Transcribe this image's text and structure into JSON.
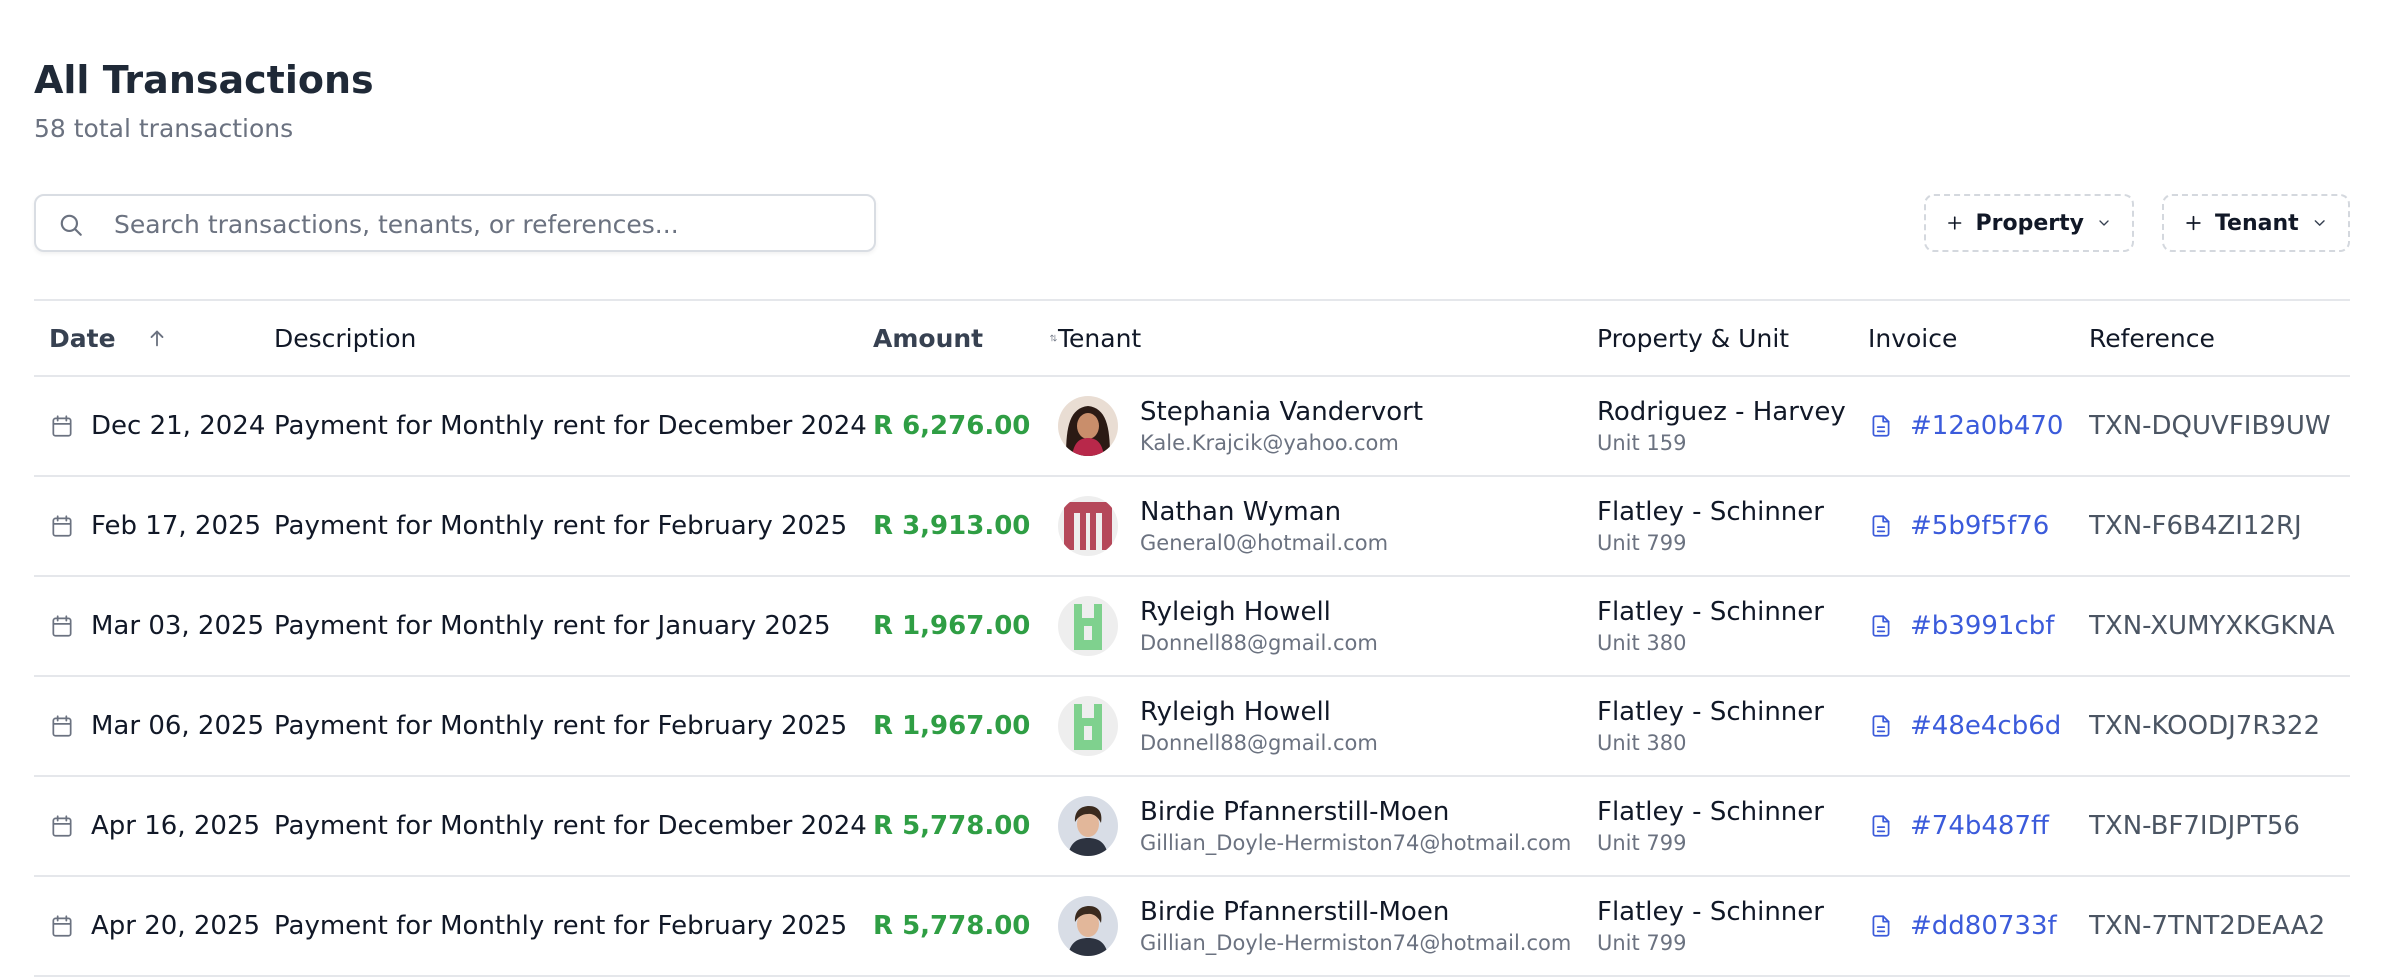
{
  "header": {
    "title": "All Transactions",
    "subtitle": "58 total transactions"
  },
  "search": {
    "placeholder": "Search transactions, tenants, or references...",
    "value": ""
  },
  "filters": [
    {
      "label": "Property",
      "icon": "plus-icon"
    },
    {
      "label": "Tenant",
      "icon": "plus-icon"
    }
  ],
  "table": {
    "columns": {
      "date": "Date",
      "description": "Description",
      "amount": "Amount",
      "tenant": "Tenant",
      "property": "Property & Unit",
      "invoice": "Invoice",
      "reference": "Reference"
    },
    "sort": {
      "date": "ascending",
      "amount": "unsorted"
    },
    "rows": [
      {
        "date": "Dec 21, 2024",
        "description": "Payment for Monthly rent for December 2024",
        "amount": "R 6,276.00",
        "tenant_name": "Stephania Vandervort",
        "tenant_email": "Kale.Krajcik@yahoo.com",
        "avatar": "photo-woman",
        "property": "Rodriguez - Harvey",
        "unit": "Unit 159",
        "invoice": "#12a0b470",
        "reference": "TXN-DQUVFIB9UW"
      },
      {
        "date": "Feb 17, 2025",
        "description": "Payment for Monthly rent for February 2025",
        "amount": "R 3,913.00",
        "tenant_name": "Nathan Wyman",
        "tenant_email": "General0@hotmail.com",
        "avatar": "identicon-red",
        "property": "Flatley - Schinner",
        "unit": "Unit 799",
        "invoice": "#5b9f5f76",
        "reference": "TXN-F6B4ZI12RJ"
      },
      {
        "date": "Mar 03, 2025",
        "description": "Payment for Monthly rent for January 2025",
        "amount": "R 1,967.00",
        "tenant_name": "Ryleigh Howell",
        "tenant_email": "Donnell88@gmail.com",
        "avatar": "identicon-green",
        "property": "Flatley - Schinner",
        "unit": "Unit 380",
        "invoice": "#b3991cbf",
        "reference": "TXN-XUMYXKGKNA"
      },
      {
        "date": "Mar 06, 2025",
        "description": "Payment for Monthly rent for February 2025",
        "amount": "R 1,967.00",
        "tenant_name": "Ryleigh Howell",
        "tenant_email": "Donnell88@gmail.com",
        "avatar": "identicon-green",
        "property": "Flatley - Schinner",
        "unit": "Unit 380",
        "invoice": "#48e4cb6d",
        "reference": "TXN-KOODJ7R322"
      },
      {
        "date": "Apr 16, 2025",
        "description": "Payment for Monthly rent for December 2024",
        "amount": "R 5,778.00",
        "tenant_name": "Birdie Pfannerstill-Moen",
        "tenant_email": "Gillian_Doyle-Hermiston74@hotmail.com",
        "avatar": "photo-man",
        "property": "Flatley - Schinner",
        "unit": "Unit 799",
        "invoice": "#74b487ff",
        "reference": "TXN-BF7IDJPT56"
      },
      {
        "date": "Apr 20, 2025",
        "description": "Payment for Monthly rent for February 2025",
        "amount": "R 5,778.00",
        "tenant_name": "Birdie Pfannerstill-Moen",
        "tenant_email": "Gillian_Doyle-Hermiston74@hotmail.com",
        "avatar": "photo-man",
        "property": "Flatley - Schinner",
        "unit": "Unit 799",
        "invoice": "#dd80733f",
        "reference": "TXN-7TNT2DEAA2"
      }
    ]
  },
  "colors": {
    "amount": "#2f9e44",
    "link": "#3b5bdb",
    "border": "#e5e7eb",
    "muted": "#6b7280",
    "identicon_red": "#b5485a",
    "identicon_green": "#7fd18e"
  }
}
